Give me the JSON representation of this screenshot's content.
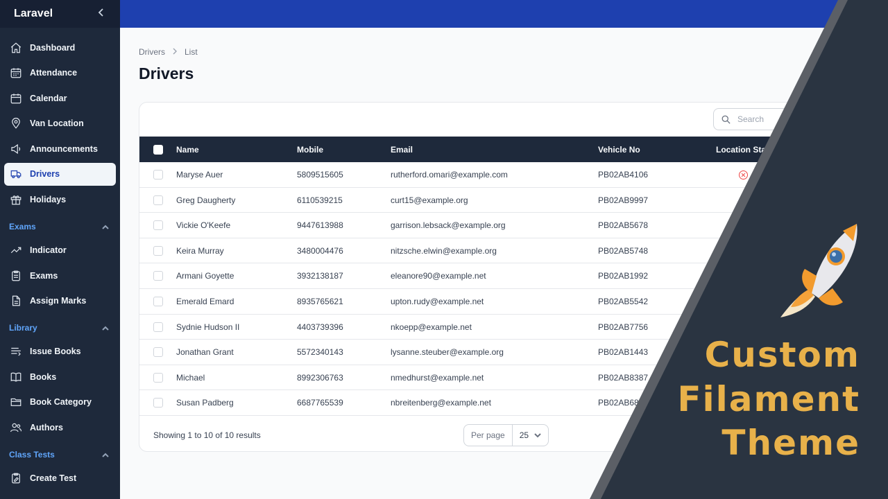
{
  "sidebar": {
    "brand": "Laravel",
    "items_top": [
      {
        "label": "Dashboard",
        "icon": "home-icon"
      },
      {
        "label": "Attendance",
        "icon": "calendar-grid-icon"
      },
      {
        "label": "Calendar",
        "icon": "calendar-icon"
      },
      {
        "label": "Van Location",
        "icon": "map-pin-icon"
      },
      {
        "label": "Announcements",
        "icon": "megaphone-icon"
      },
      {
        "label": "Drivers",
        "icon": "truck-icon",
        "active": true
      },
      {
        "label": "Holidays",
        "icon": "gift-icon"
      }
    ],
    "group_exams": "Exams",
    "items_exams": [
      {
        "label": "Indicator",
        "icon": "trend-icon"
      },
      {
        "label": "Exams",
        "icon": "clipboard-icon"
      },
      {
        "label": "Assign Marks",
        "icon": "document-icon"
      }
    ],
    "group_library": "Library",
    "items_library": [
      {
        "label": "Issue Books",
        "icon": "bars-icon"
      },
      {
        "label": "Books",
        "icon": "book-icon"
      },
      {
        "label": "Book Category",
        "icon": "folder-icon"
      },
      {
        "label": "Authors",
        "icon": "users-icon"
      }
    ],
    "group_class_tests": "Class Tests",
    "items_class_tests": [
      {
        "label": "Create Test",
        "icon": "clipboard-edit-icon"
      }
    ]
  },
  "breadcrumb": {
    "parent": "Drivers",
    "current": "List"
  },
  "page_title": "Drivers",
  "search": {
    "placeholder": "Search"
  },
  "table": {
    "columns": [
      "Name",
      "Mobile",
      "Email",
      "Vehicle No",
      "Location Stat"
    ],
    "rows": [
      {
        "name": "Maryse Auer",
        "mobile": "5809515605",
        "email": "rutherford.omari@example.com",
        "vehicle": "PB02AB4106"
      },
      {
        "name": "Greg Daugherty",
        "mobile": "6110539215",
        "email": "curt15@example.org",
        "vehicle": "PB02AB9997"
      },
      {
        "name": "Vickie O'Keefe",
        "mobile": "9447613988",
        "email": "garrison.lebsack@example.org",
        "vehicle": "PB02AB5678"
      },
      {
        "name": "Keira Murray",
        "mobile": "3480004476",
        "email": "nitzsche.elwin@example.org",
        "vehicle": "PB02AB5748"
      },
      {
        "name": "Armani Goyette",
        "mobile": "3932138187",
        "email": "eleanore90@example.net",
        "vehicle": "PB02AB1992"
      },
      {
        "name": "Emerald Emard",
        "mobile": "8935765621",
        "email": "upton.rudy@example.net",
        "vehicle": "PB02AB5542"
      },
      {
        "name": "Sydnie Hudson II",
        "mobile": "4403739396",
        "email": "nkoepp@example.net",
        "vehicle": "PB02AB7756"
      },
      {
        "name": "Jonathan Grant",
        "mobile": "5572340143",
        "email": "lysanne.steuber@example.org",
        "vehicle": "PB02AB1443"
      },
      {
        "name": "Michael",
        "mobile": "8992306763",
        "email": "nmedhurst@example.net",
        "vehicle": "PB02AB8387"
      },
      {
        "name": "Susan Padberg",
        "mobile": "6687765539",
        "email": "nbreitenberg@example.net",
        "vehicle": "PB02AB685"
      }
    ]
  },
  "footer": {
    "showing": "Showing 1 to 10 of 10 results",
    "per_page_label": "Per page",
    "per_page_value": "25"
  },
  "promo": {
    "line1": "Custom",
    "line2": "Filament",
    "line3": "Theme"
  },
  "colors": {
    "sidebar": "#1e293b",
    "topbar": "#1e40af",
    "accent_text": "#e8b14a",
    "overlay": "#2a3441"
  }
}
